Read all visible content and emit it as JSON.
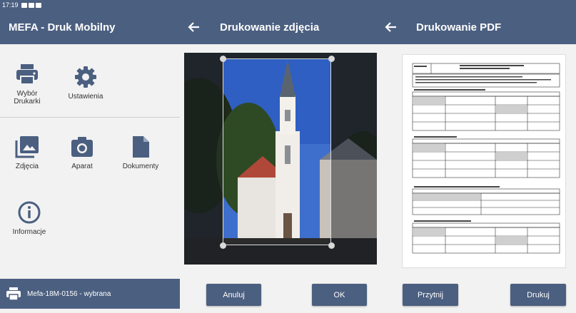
{
  "status_bar": {
    "time": "17:19"
  },
  "home": {
    "title": "MEFA - Druk Mobilny",
    "tiles": {
      "printer": "Wybór\nDrukarki",
      "settings": "Ustawienia",
      "photos": "Zdjęcia",
      "camera": "Aparat",
      "documents": "Dokumenty",
      "info": "Informacje"
    },
    "printer_status": "Mefa-18M-0156 - wybrana"
  },
  "photo_print": {
    "title": "Drukowanie zdjęcia",
    "cancel_label": "Anuluj",
    "ok_label": "OK"
  },
  "pdf_print": {
    "title": "Drukowanie PDF",
    "rotate_label": "Przytnij",
    "print_label": "Drukuj"
  },
  "colors": {
    "bar": "#4b5f80",
    "background": "#f2f2f2",
    "icon": "#4b5f80"
  }
}
